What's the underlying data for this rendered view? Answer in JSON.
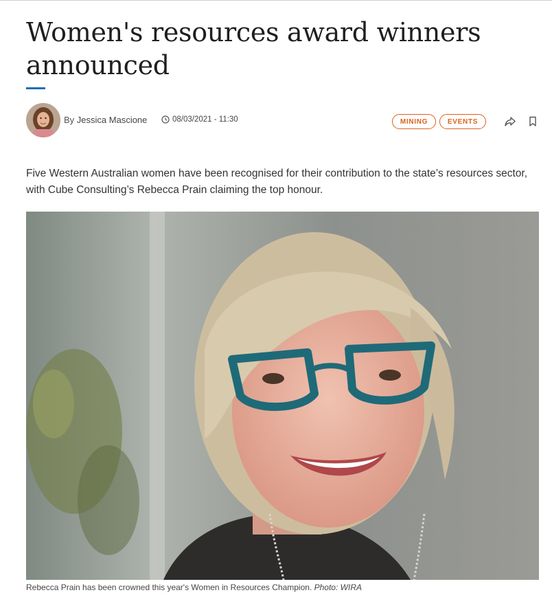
{
  "article": {
    "title": "Women's resources award winners announced",
    "author_prefix": "By",
    "author_name": "Jessica Mascione",
    "timestamp": "08/03/2021 - 11:30",
    "tags": [
      "MINING",
      "EVENTS"
    ],
    "lead": "Five Western Australian women have been recognised for their contribution to the state’s resources sector, with Cube Consulting’s Rebecca Prain claiming the top honour.",
    "caption": "Rebecca Prain has been crowned this year's Women in Resources Champion.",
    "photo_credit": "Photo: WIRA"
  },
  "icons": {
    "clock": "clock-icon",
    "share": "share-icon",
    "bookmark": "bookmark-icon"
  },
  "colors": {
    "accent_blue": "#1f6fb2",
    "tag_orange": "#d9621c",
    "text_dark": "#1f1f1f"
  }
}
